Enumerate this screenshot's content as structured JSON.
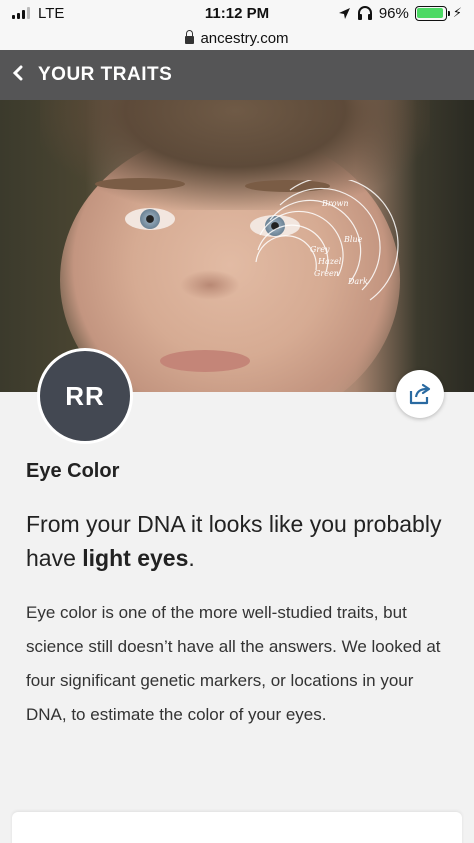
{
  "status_bar": {
    "carrier": "LTE",
    "time": "11:12 PM",
    "battery_percent": "96%",
    "battery_level": 0.96
  },
  "url_bar": {
    "domain": "ancestry.com"
  },
  "header": {
    "back_icon": "chevron-left-icon",
    "title": "YOUR TRAITS"
  },
  "hero": {
    "overlay_labels": [
      "Brown",
      "Blue",
      "Grey",
      "Hazel",
      "Green",
      "Dark"
    ]
  },
  "trait": {
    "avatar_text": "RR",
    "share_icon": "share-icon",
    "title": "Eye Color",
    "headline_prefix": "From your DNA it looks like you probably have ",
    "headline_bold": "light eyes",
    "headline_suffix": ".",
    "description": "Eye color is one of the more well-studied traits, but science still doesn’t have all the answers. We looked at four significant genetic markers, or locations in your DNA, to estimate the color of your eyes."
  },
  "colors": {
    "header_bg": "#555556",
    "avatar_bg": "#434852",
    "accent_blue": "#2a6aa1",
    "battery_green": "#4cd964"
  }
}
